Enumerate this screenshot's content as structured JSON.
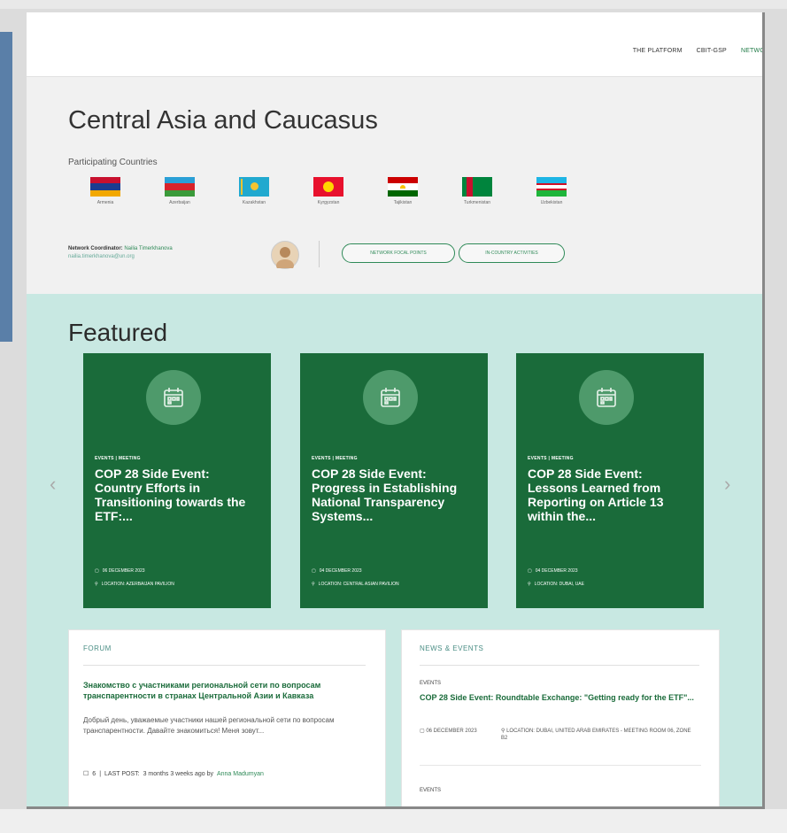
{
  "nav": {
    "items": [
      "THE PLATFORM",
      "CBIT-GSP",
      "NETWO"
    ]
  },
  "region": {
    "title": "Central Asia and Caucasus",
    "participating_label": "Participating Countries",
    "countries": [
      "Armenia",
      "Azerbaijan",
      "Kazakhstan",
      "Kyrgyzstan",
      "Tajikistan",
      "Turkmenistan",
      "Uzbekistan"
    ]
  },
  "coordinator": {
    "label": "Network Coordinator:",
    "name": "Nailia Timerkhanova",
    "email": "nailia.timerkhanova@un.org"
  },
  "buttons": {
    "focal_points": "NETWORK FOCAL POINTS",
    "in_country": "IN-COUNTRY ACTIVITIES"
  },
  "featured": {
    "title": "Featured",
    "cards": [
      {
        "category": "EVENTS | MEETING",
        "title": "COP 28 Side Event: Country Efforts in Transitioning towards the ETF:...",
        "date": "06 DECEMBER 2023",
        "location": "LOCATION: AZERBAIJAN PAVILION"
      },
      {
        "category": "EVENTS | MEETING",
        "title": "COP 28 Side Event: Progress in Establishing National Transparency Systems...",
        "date": "04 DECEMBER 2023",
        "location": "LOCATION: CENTRAL ASIAN PAVILION"
      },
      {
        "category": "EVENTS | MEETING",
        "title": "COP 28 Side Event: Lessons Learned from Reporting on Article 13 within the...",
        "date": "04 DECEMBER 2023",
        "location": "LOCATION: DUBAI, UAE"
      }
    ]
  },
  "forum": {
    "heading": "FORUM",
    "post_title": "Знакомство с участниками региональной сети по вопросам транспарентности в странах Центральной Азии и Кавказа",
    "post_body": "Добрый день, уважаемые участники нашей региональной сети по вопросам транспарентности. Давайте знакомиться! Меня зовут...",
    "reply_count": "6",
    "last_post_label": "LAST POST:",
    "last_post_time": "3 months 3 weeks ago by",
    "last_post_author": "Anna Madumyan"
  },
  "news": {
    "heading": "NEWS & EVENTS",
    "items": [
      {
        "tag": "EVENTS",
        "title": "COP 28 Side Event: Roundtable Exchange: \"Getting ready for the ETF\"...",
        "date": "06 DECEMBER 2023",
        "location": "LOCATION: DUBAI, UNITED ARAB EMIRATES - MEETING ROOM 06, ZONE B2"
      },
      {
        "tag": "EVENTS"
      }
    ]
  },
  "colors": {
    "brand_green": "#1a6b3a",
    "accent_green": "#2f8a58",
    "featured_bg": "#c8e8e2"
  }
}
